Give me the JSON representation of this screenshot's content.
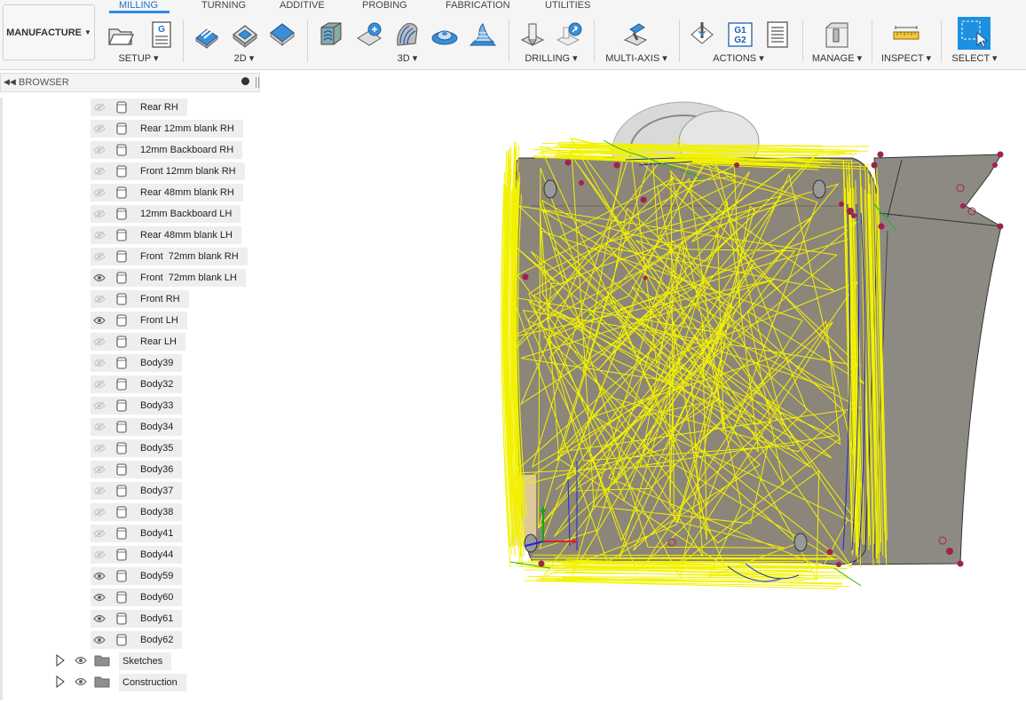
{
  "workspace": {
    "label": "MANUFACTURE"
  },
  "tabs": [
    {
      "label": "MILLING",
      "active": true
    },
    {
      "label": "TURNING"
    },
    {
      "label": "ADDITIVE"
    },
    {
      "label": "PROBING"
    },
    {
      "label": "FABRICATION"
    },
    {
      "label": "UTILITIES"
    }
  ],
  "groups": {
    "setup": "SETUP ▾",
    "g2d": "2D ▾",
    "g3d": "3D ▾",
    "drilling": "DRILLING ▾",
    "multiaxis": "MULTI-AXIS ▾",
    "actions": "ACTIONS ▾",
    "manage": "MANAGE ▾",
    "inspect": "INSPECT ▾",
    "select": "SELECT ▾"
  },
  "icons": {
    "g_badge": "G",
    "g1g2": "G1\nG2"
  },
  "browser": {
    "title": "BROWSER",
    "bodies": [
      {
        "label": "Rear RH",
        "visible": false
      },
      {
        "label": "Rear 12mm blank RH",
        "visible": false
      },
      {
        "label": "12mm Backboard RH",
        "visible": false
      },
      {
        "label": "Front 12mm blank RH",
        "visible": false
      },
      {
        "label": "Rear 48mm blank RH",
        "visible": false
      },
      {
        "label": "12mm Backboard LH",
        "visible": false
      },
      {
        "label": "Rear 48mm blank LH",
        "visible": false
      },
      {
        "label": "Front  72mm blank RH",
        "visible": false
      },
      {
        "label": "Front  72mm blank LH",
        "visible": true
      },
      {
        "label": "Front RH",
        "visible": false
      },
      {
        "label": "Front LH",
        "visible": true
      },
      {
        "label": "Rear LH",
        "visible": false
      },
      {
        "label": "Body39",
        "visible": false
      },
      {
        "label": "Body32",
        "visible": false
      },
      {
        "label": "Body33",
        "visible": false
      },
      {
        "label": "Body34",
        "visible": false
      },
      {
        "label": "Body35",
        "visible": false
      },
      {
        "label": "Body36",
        "visible": false
      },
      {
        "label": "Body37",
        "visible": false
      },
      {
        "label": "Body38",
        "visible": false
      },
      {
        "label": "Body41",
        "visible": false
      },
      {
        "label": "Body44",
        "visible": false
      },
      {
        "label": "Body59",
        "visible": true
      },
      {
        "label": "Body60",
        "visible": true
      },
      {
        "label": "Body61",
        "visible": true
      },
      {
        "label": "Body62",
        "visible": true
      }
    ],
    "folders": [
      {
        "label": "Sketches"
      },
      {
        "label": "Construction"
      }
    ]
  },
  "colors": {
    "accent": "#1a73c8",
    "toolpath": "#f2f200",
    "model": "#8a8478",
    "select_blue": "#1e90e0"
  }
}
